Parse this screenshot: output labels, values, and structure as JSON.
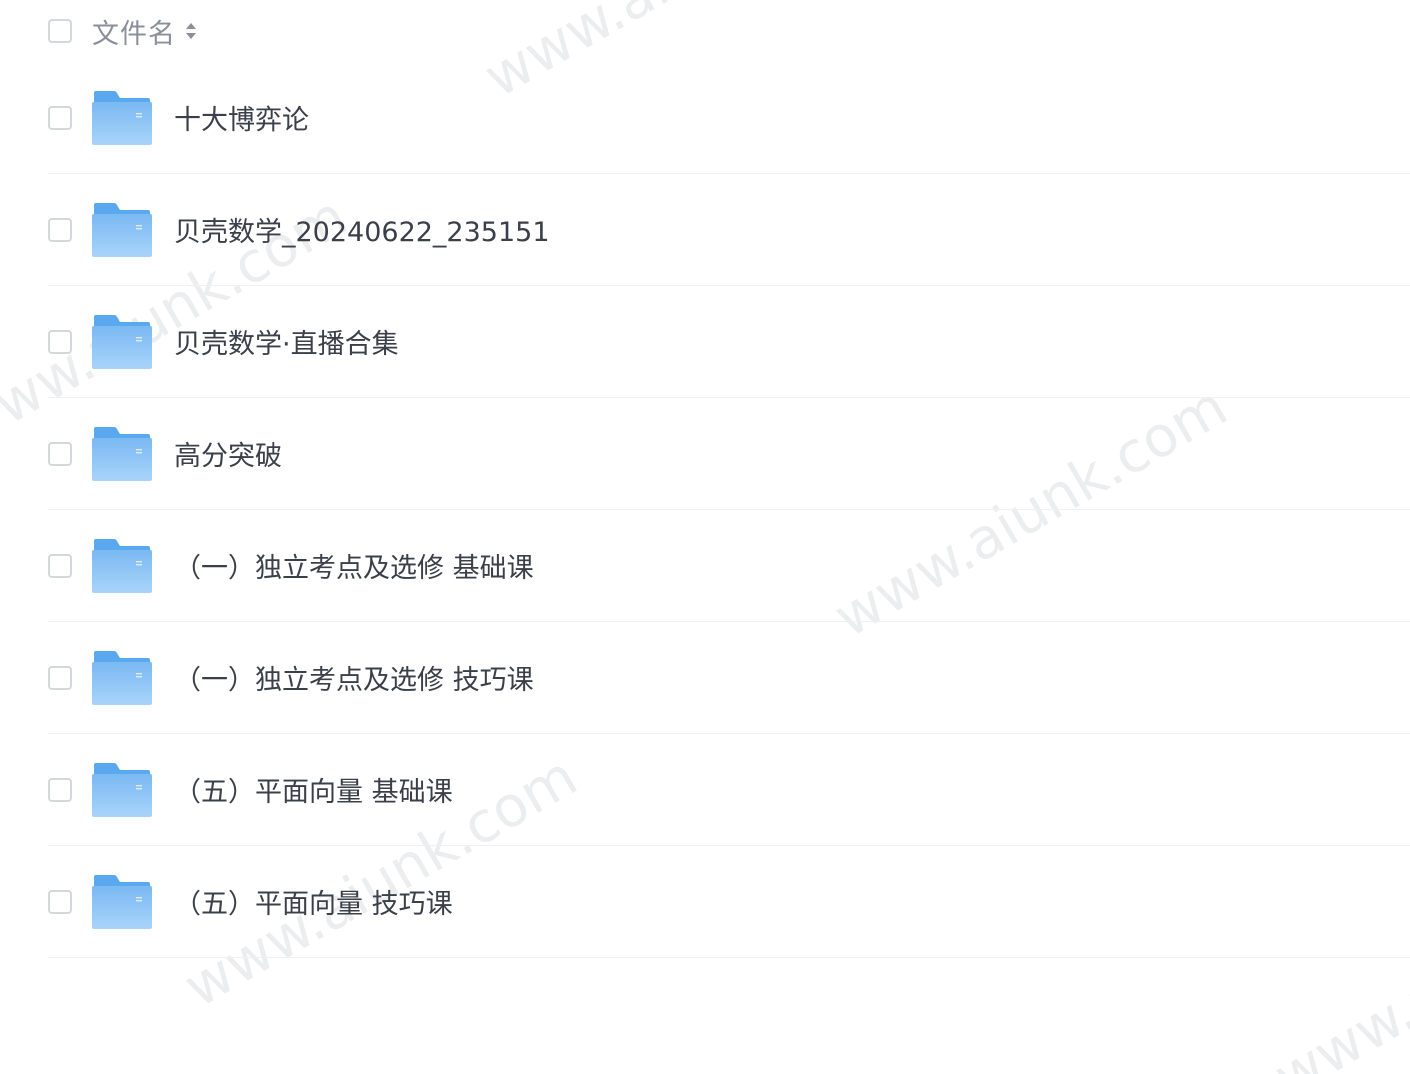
{
  "header": {
    "column_label": "文件名"
  },
  "files": [
    {
      "name": "十大博弈论",
      "type": "folder"
    },
    {
      "name": "贝壳数学_20240622_235151",
      "type": "folder"
    },
    {
      "name": "贝壳数学·直播合集",
      "type": "folder"
    },
    {
      "name": "高分突破",
      "type": "folder"
    },
    {
      "name": "（一）独立考点及选修 基础课",
      "type": "folder"
    },
    {
      "name": "（一）独立考点及选修 技巧课",
      "type": "folder"
    },
    {
      "name": "（五）平面向量 基础课",
      "type": "folder"
    },
    {
      "name": "（五）平面向量 技巧课",
      "type": "folder"
    }
  ],
  "icons": {
    "folder": "folder-icon",
    "sort": "sort-icon",
    "checkbox": "checkbox"
  },
  "colors": {
    "folder_blue": "#5aa8ee",
    "folder_light": "#8cc6f7",
    "text": "#3a3f4a",
    "header_text": "#8a8f99",
    "divider": "#eef0f3"
  },
  "watermark": {
    "text": "www.aiunk.com"
  }
}
